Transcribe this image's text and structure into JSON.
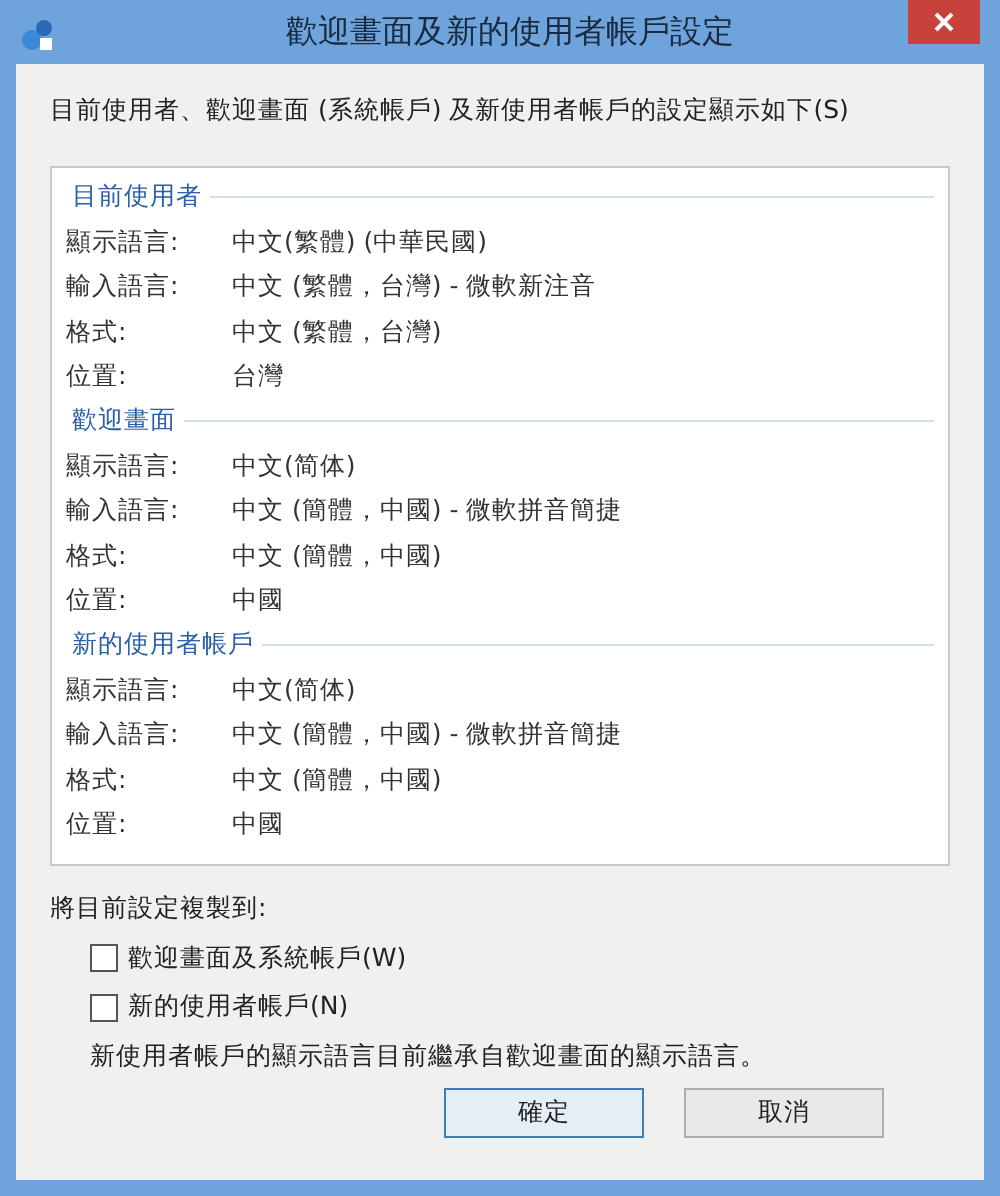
{
  "window": {
    "title": "歡迎畫面及新的使用者帳戶設定"
  },
  "intro": "目前使用者、歡迎畫面 (系統帳戶) 及新使用者帳戶的設定顯示如下(S)",
  "sections": [
    {
      "heading": "目前使用者",
      "rows": [
        {
          "label": "顯示語言:",
          "value": "中文(繁體) (中華民國)"
        },
        {
          "label": "輸入語言:",
          "value": "中文 (繁體，台灣) - 微軟新注音"
        },
        {
          "label": "格式:",
          "value": "中文 (繁體，台灣)"
        },
        {
          "label": "位置:",
          "value": "台灣"
        }
      ]
    },
    {
      "heading": "歡迎畫面",
      "rows": [
        {
          "label": "顯示語言:",
          "value": "中文(简体)"
        },
        {
          "label": "輸入語言:",
          "value": "中文 (簡體，中國) - 微軟拼音簡捷"
        },
        {
          "label": "格式:",
          "value": "中文 (簡體，中國)"
        },
        {
          "label": "位置:",
          "value": "中國"
        }
      ]
    },
    {
      "heading": "新的使用者帳戶",
      "rows": [
        {
          "label": "顯示語言:",
          "value": "中文(简体)"
        },
        {
          "label": "輸入語言:",
          "value": "中文 (簡體，中國) - 微軟拼音簡捷"
        },
        {
          "label": "格式:",
          "value": "中文 (簡體，中國)"
        },
        {
          "label": "位置:",
          "value": "中國"
        }
      ]
    }
  ],
  "copy_label": "將目前設定複製到:",
  "checkboxes": [
    {
      "label": "歡迎畫面及系統帳戶(W)",
      "checked": false
    },
    {
      "label": "新的使用者帳戶(N)",
      "checked": false
    }
  ],
  "note": "新使用者帳戶的顯示語言目前繼承自歡迎畫面的顯示語言。",
  "buttons": [
    "確定",
    "取消"
  ]
}
